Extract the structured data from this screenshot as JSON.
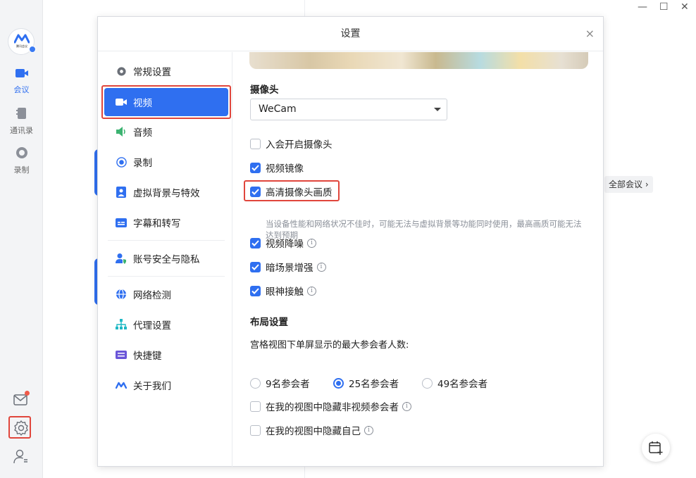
{
  "rail": {
    "logo_caption": "腾讯会议",
    "items": [
      {
        "label": "会议"
      },
      {
        "label": "通讯录"
      },
      {
        "label": "录制"
      }
    ]
  },
  "background": {
    "all_meetings_label": "全部会议",
    "all_meetings_chevron": "›"
  },
  "window_controls": {
    "minimize": "—",
    "maximize": "☐",
    "close": "✕"
  },
  "dialog": {
    "title": "设置",
    "close_symbol": "×",
    "nav": [
      {
        "label": "常规设置",
        "icon": "gear-icon"
      },
      {
        "label": "视频",
        "icon": "video-camera-icon",
        "active": true
      },
      {
        "label": "音频",
        "icon": "speaker-icon"
      },
      {
        "label": "录制",
        "icon": "record-icon"
      },
      {
        "label": "虚拟背景与特效",
        "icon": "portrait-icon"
      },
      {
        "label": "字幕和转写",
        "icon": "subtitles-icon"
      },
      {
        "label": "账号安全与隐私",
        "icon": "user-shield-icon"
      },
      {
        "label": "网络检测",
        "icon": "globe-icon"
      },
      {
        "label": "代理设置",
        "icon": "hierarchy-icon"
      },
      {
        "label": "快捷键",
        "icon": "keyboard-icon"
      },
      {
        "label": "关于我们",
        "icon": "app-logo-icon"
      }
    ],
    "video": {
      "camera_title": "摄像头",
      "camera_value": "WeCam",
      "checkboxes": [
        {
          "label": "入会开启摄像头",
          "checked": false
        },
        {
          "label": "视频镜像",
          "checked": true
        },
        {
          "label": "高清摄像头画质",
          "checked": true
        },
        {
          "label": "视频降噪",
          "checked": true
        },
        {
          "label": "暗场景增强",
          "checked": true
        },
        {
          "label": "眼神接触",
          "checked": true
        }
      ],
      "hd_hint": "当设备性能和网络状况不佳时，可能无法与虚拟背景等功能同时使用，最高画质可能无法达到预期",
      "layout_title": "布局设置",
      "max_participants_label": "宫格视图下单屏显示的最大参会者人数:",
      "radios": [
        {
          "label": "9名参会者",
          "selected": false
        },
        {
          "label": "25名参会者",
          "selected": true
        },
        {
          "label": "49名参会者",
          "selected": false
        }
      ],
      "layout_checkboxes": [
        {
          "label": "在我的视图中隐藏非视频参会者",
          "checked": false
        },
        {
          "label": "在我的视图中隐藏自己",
          "checked": false
        }
      ]
    }
  },
  "colors": {
    "accent": "#2f6ff0",
    "highlight_box": "#e0463c"
  }
}
